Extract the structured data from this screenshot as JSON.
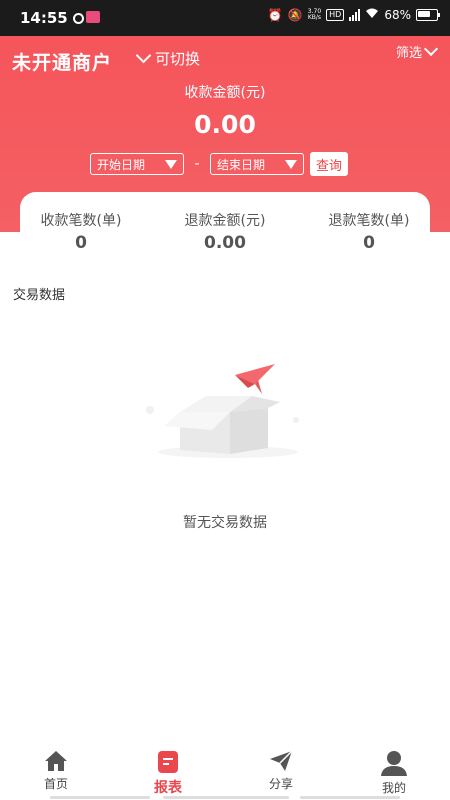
{
  "status_bar": {
    "time": "14:55",
    "net_speed_top": "3.70",
    "net_speed_bottom": "KB/s",
    "hd": "HD",
    "battery": "68%"
  },
  "header": {
    "merchant_name": "未开通商户",
    "switch_label": "可切换",
    "filter_label": "筛选",
    "amount_label": "收款金额(元)",
    "amount_value": "0.00",
    "start_date": "开始日期",
    "date_separator": "-",
    "end_date": "结束日期",
    "query_label": "查询"
  },
  "stats": [
    {
      "label": "收款笔数(单)",
      "value": "0"
    },
    {
      "label": "退款金额(元)",
      "value": "0.00"
    },
    {
      "label": "退款笔数(单)",
      "value": "0"
    }
  ],
  "section": {
    "title": "交易数据"
  },
  "empty": {
    "text": "暂无交易数据",
    "icon": "empty-box-icon"
  },
  "colors": {
    "brand": "#f5555b",
    "accent": "#e9474c"
  },
  "tabbar": {
    "items": [
      {
        "label": "首页",
        "icon": "home-icon",
        "active": false
      },
      {
        "label": "报表",
        "icon": "report-icon",
        "active": true
      },
      {
        "label": "分享",
        "icon": "share-icon",
        "active": false
      },
      {
        "label": "我的",
        "icon": "user-icon",
        "active": false
      }
    ]
  }
}
